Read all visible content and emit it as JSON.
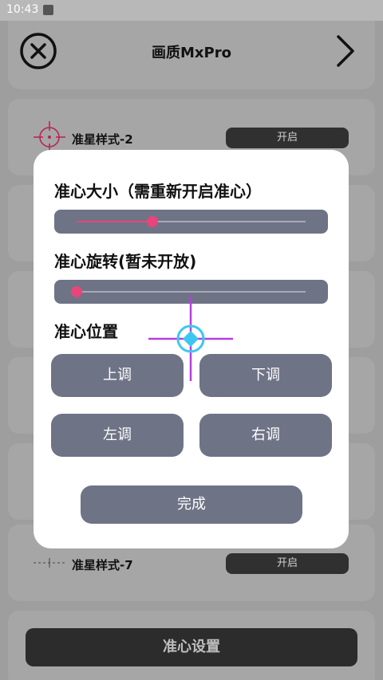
{
  "status_bar": {
    "time": "10:43"
  },
  "header": {
    "title": "画质MxPro"
  },
  "style_rows": [
    {
      "label": "准星样式-2",
      "toggle": "开启"
    },
    {
      "label": "准星样式-7",
      "toggle": "开启"
    }
  ],
  "dialog": {
    "size_heading": "准心大小（需重新开启准心）",
    "rotation_heading": "准心旋转(暂未开放)",
    "position_heading": "准心位置",
    "size_value": 0.33,
    "rotation_value": 0.0,
    "buttons": {
      "up": "上调",
      "down": "下调",
      "left": "左调",
      "right": "右调"
    },
    "done": "完成"
  },
  "bottom": {
    "label": "准心设置"
  },
  "colors": {
    "accent": "#e8457b",
    "button": "#6f7386",
    "crosshair_preview": "#b63fe0",
    "crosshair_center": "#3cc7f0"
  }
}
